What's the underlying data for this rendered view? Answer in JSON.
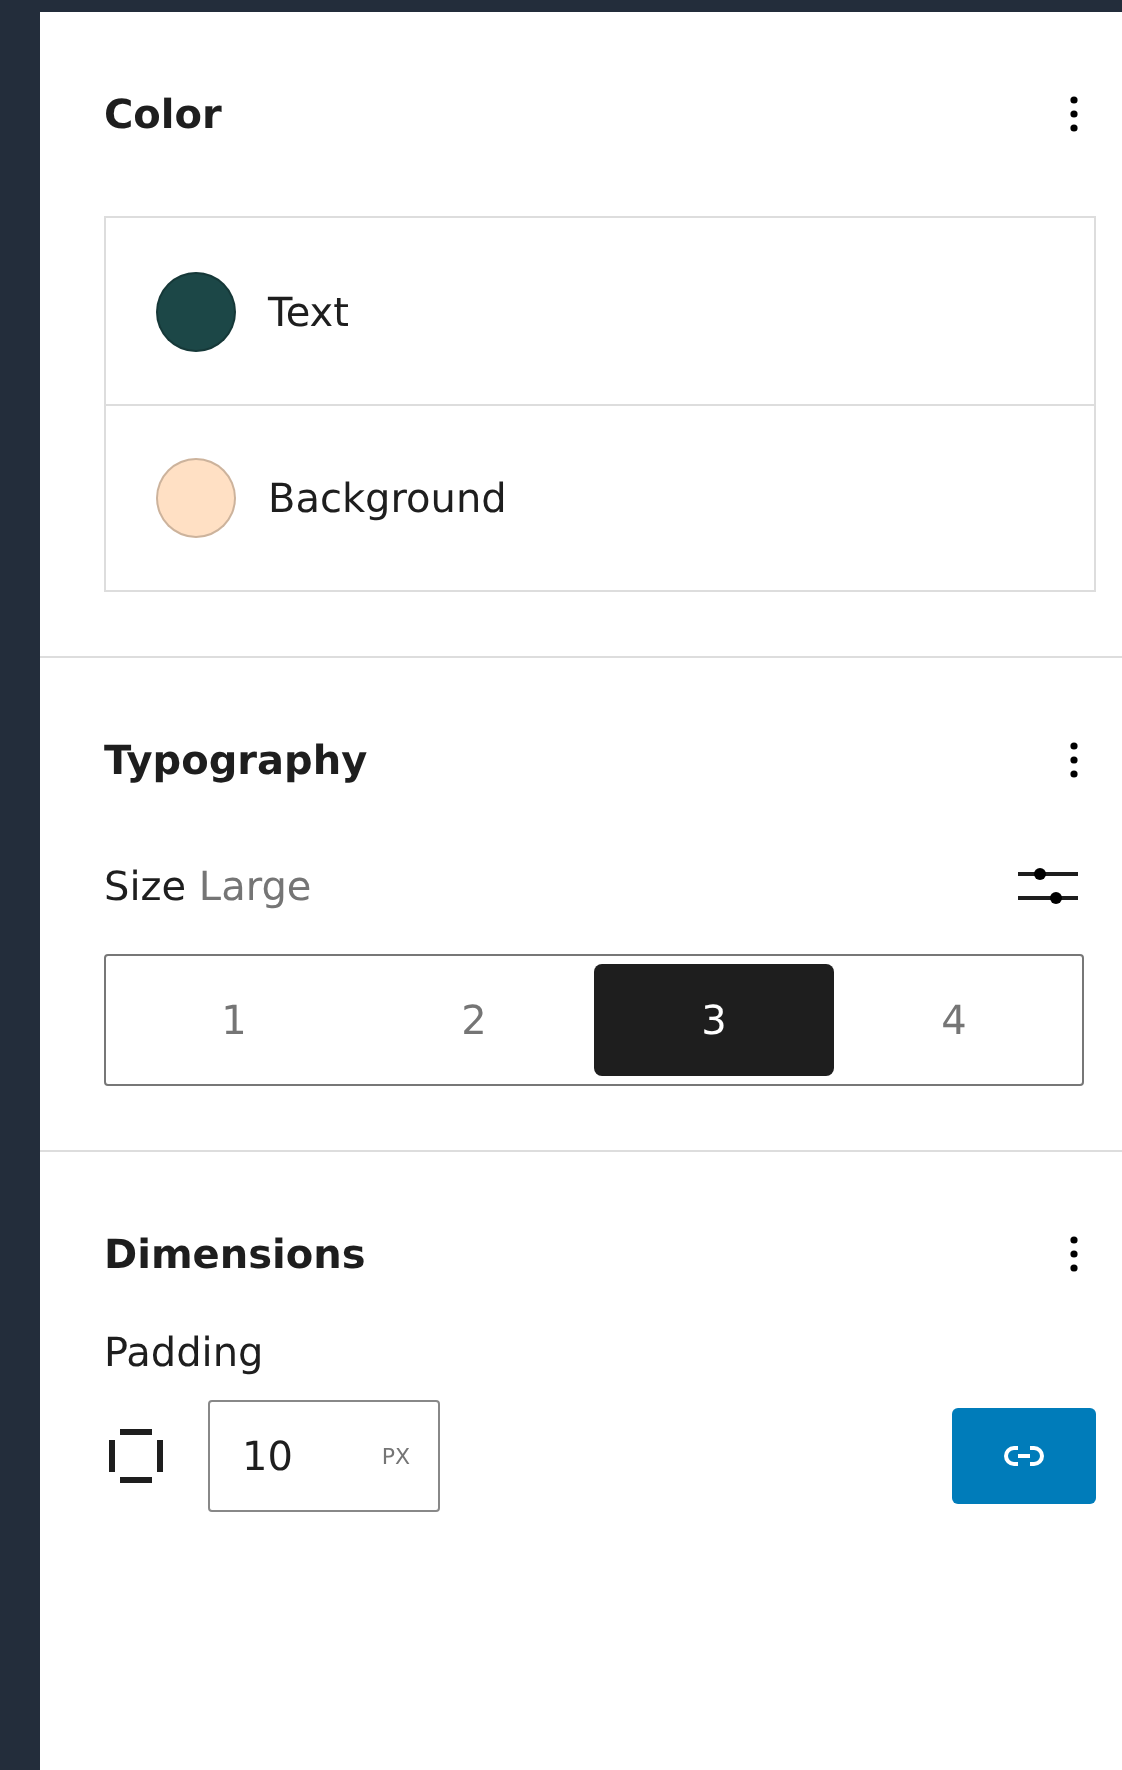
{
  "sections": [
    {
      "kind": "color",
      "title": "Color",
      "items": [
        {
          "label": "Text",
          "color": "#1c4747"
        },
        {
          "label": "Background",
          "color": "#ffe0c4"
        }
      ]
    },
    {
      "kind": "typography",
      "title": "Typography",
      "size_label": "Size",
      "size_value": "Large",
      "options": [
        {
          "label": "1",
          "selected": false
        },
        {
          "label": "2",
          "selected": false
        },
        {
          "label": "3",
          "selected": true
        },
        {
          "label": "4",
          "selected": false
        }
      ]
    },
    {
      "kind": "dimensions",
      "title": "Dimensions",
      "padding_label": "Padding",
      "value": "10",
      "unit": "PX",
      "linked": true
    }
  ]
}
